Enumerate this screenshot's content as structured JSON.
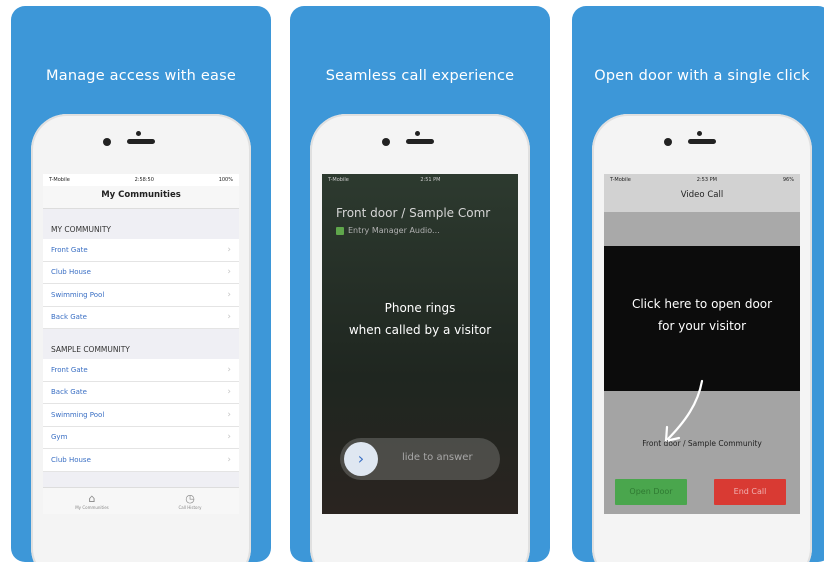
{
  "cards": [
    {
      "title": "Manage access with ease",
      "status": {
        "left": "T-Mobile",
        "time": "2:58:50",
        "right": "100%"
      },
      "nav_title": "My Communities",
      "sections": [
        {
          "header": "MY COMMUNITY",
          "items": [
            "Front Gate",
            "Club House",
            "Swimming Pool",
            "Back Gate"
          ]
        },
        {
          "header": "SAMPLE COMMUNITY",
          "items": [
            "Front Gate",
            "Back Gate",
            "Swimming Pool",
            "Gym",
            "Club House"
          ]
        }
      ],
      "tabs": [
        {
          "label": "My Communities",
          "icon": "home-icon"
        },
        {
          "label": "Call History",
          "icon": "clock-icon"
        }
      ]
    },
    {
      "title": "Seamless call experience",
      "status": {
        "left": "T-Mobile",
        "time": "2:51 PM",
        "right": ""
      },
      "caller": "Front door / Sample Comr",
      "caller_sub": "Entry Manager Audio...",
      "overlay_line1": "Phone rings",
      "overlay_line2": "when called by a visitor",
      "slider_text": "lide to answer"
    },
    {
      "title": "Open door with a single click",
      "status": {
        "left": "T-Mobile",
        "time": "2:53 PM",
        "right": "96%"
      },
      "nav_title": "Video Call",
      "overlay_line1": "Click here to open door",
      "overlay_line2": "for your visitor",
      "community_text": "Front door / Sample Community",
      "open_label": "Open Door",
      "end_label": "End Call"
    }
  ],
  "colors": {
    "card_bg": "#3d97d8",
    "link": "#3a6fc4",
    "open_btn": "#4aa64d",
    "end_btn": "#d93a33"
  }
}
